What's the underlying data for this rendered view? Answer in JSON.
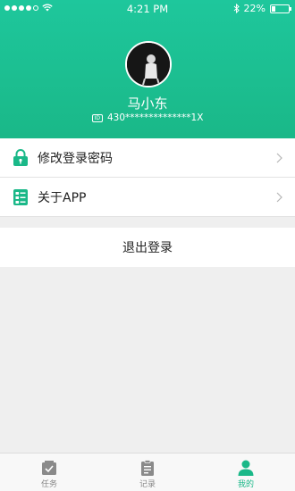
{
  "status_bar": {
    "time": "4:21 PM",
    "battery_percent": "22%",
    "battery_level": 0.22
  },
  "profile": {
    "name": "马小东",
    "id_badge": "ID",
    "id_number": "430**************1X"
  },
  "menu": {
    "items": [
      {
        "label": "修改登录密码",
        "icon": "lock-icon"
      },
      {
        "label": "关于APP",
        "icon": "info-card-icon"
      }
    ],
    "logout_label": "退出登录"
  },
  "tabbar": {
    "tabs": [
      {
        "label": "任务",
        "icon": "task-icon",
        "active": false
      },
      {
        "label": "记录",
        "icon": "clipboard-icon",
        "active": false
      },
      {
        "label": "我的",
        "icon": "person-icon",
        "active": true
      }
    ]
  },
  "colors": {
    "brand": "#1ab888",
    "header_top": "#1ec79c",
    "inactive": "#888888"
  }
}
